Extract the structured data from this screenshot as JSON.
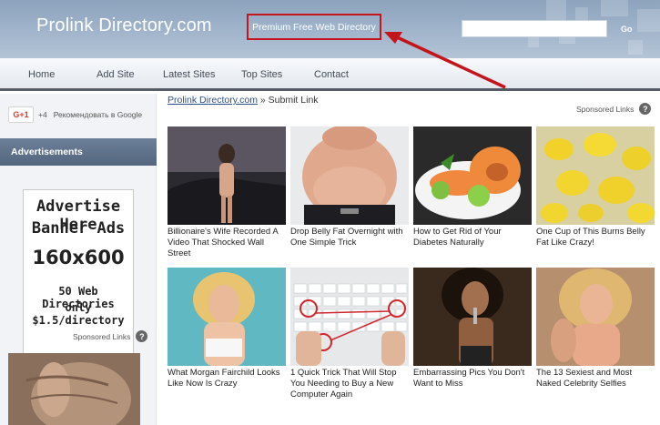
{
  "header": {
    "site_title": "Prolink Directory.com",
    "tagline": "Premium Free Web Directory",
    "search_button": "Go",
    "search_placeholder": ""
  },
  "nav": [
    "Home",
    "Add Site",
    "Latest Sites",
    "Top Sites",
    "Contact"
  ],
  "sidebar": {
    "gplus_button": "G+1",
    "gplus_count": "+4",
    "gplus_label": "Рекомендовать в Google",
    "ads_heading": "Advertisements",
    "banner": {
      "line1": "Advertise Here",
      "line2": "Banner Ads",
      "line3": "160x600",
      "line4": "50 Web Directories",
      "line5": "only $1.5/directory"
    },
    "sponsored": "Sponsored Links"
  },
  "main": {
    "breadcrumb_link": "Prolink Directory.com",
    "breadcrumb_rest": " » Submit Link",
    "sponsored": "Sponsored Links",
    "cards": [
      {
        "caption": "Billionaire's Wife Recorded A Video That Shocked Wall Street"
      },
      {
        "caption": "Drop Belly Fat Overnight with One Simple Trick"
      },
      {
        "caption": "How to Get Rid of Your Diabetes Naturally"
      },
      {
        "caption": "One Cup of This Burns Belly Fat Like Crazy!"
      },
      {
        "caption": "What Morgan Fairchild Looks Like Now Is Crazy"
      },
      {
        "caption": "1 Quick Trick That Will Stop You Needing to Buy a New Computer Again"
      },
      {
        "caption": "Embarrassing Pics You Don't Want to Miss"
      },
      {
        "caption": "The 13 Sexiest and Most Naked Celebrity Selfies"
      }
    ]
  },
  "colors": {
    "header_bg": "#9fb3ca",
    "highlight_red": "#c4151c",
    "ads_header_bg": "#5f728b",
    "link_blue": "#2a4f88"
  }
}
